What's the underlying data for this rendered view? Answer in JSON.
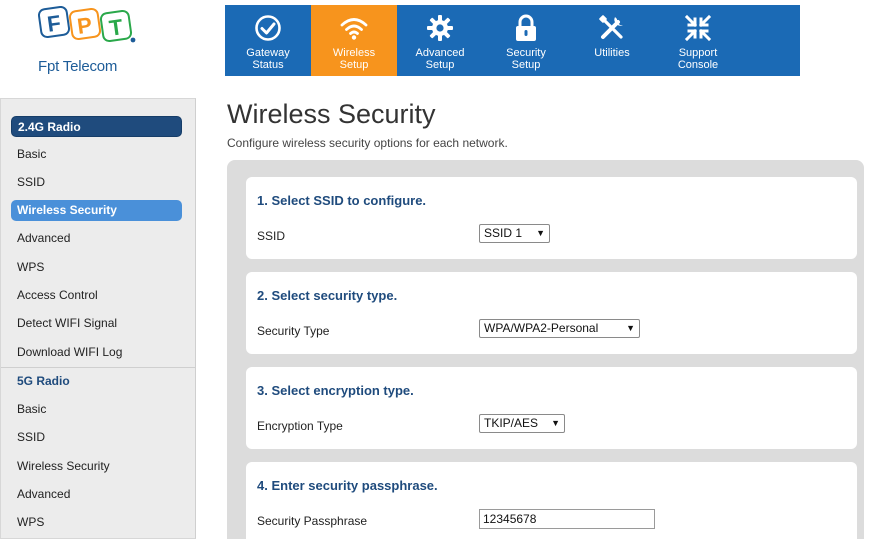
{
  "brand": {
    "logo_letters": [
      "F",
      "P",
      "T"
    ],
    "logo_colors": [
      "#1d5c98",
      "#f7941d",
      "#2aa84a"
    ],
    "name": "Fpt Telecom"
  },
  "nav": {
    "items": [
      {
        "label": "Gateway\nStatus",
        "icon": "check-circle-icon",
        "active": false
      },
      {
        "label": "Wireless\nSetup",
        "icon": "wifi-icon",
        "active": true
      },
      {
        "label": "Advanced\nSetup",
        "icon": "gear-icon",
        "active": false
      },
      {
        "label": "Security\nSetup",
        "icon": "lock-icon",
        "active": false
      },
      {
        "label": "Utilities",
        "icon": "tools-icon",
        "active": false
      },
      {
        "label": "Support\nConsole",
        "icon": "compress-arrows-icon",
        "active": false
      }
    ]
  },
  "sidebar": {
    "group_24": "2.4G Radio",
    "items_24": [
      "Basic",
      "SSID",
      "Wireless Security",
      "Advanced",
      "WPS",
      "Access Control",
      "Detect WIFI Signal",
      "Download WIFI Log"
    ],
    "active_24": "Wireless Security",
    "group_5": "5G Radio",
    "items_5": [
      "Basic",
      "SSID",
      "Wireless Security",
      "Advanced",
      "WPS"
    ]
  },
  "page": {
    "title": "Wireless Security",
    "subtitle": "Configure wireless security options for each network."
  },
  "sections": {
    "ssid": {
      "title": "1. Select SSID to configure.",
      "label": "SSID",
      "value": "SSID 1"
    },
    "security": {
      "title": "2. Select security type.",
      "label": "Security Type",
      "value": "WPA/WPA2-Personal"
    },
    "encryption": {
      "title": "3. Select encryption type.",
      "label": "Encryption Type",
      "value": "TKIP/AES"
    },
    "passphrase": {
      "title": "4. Enter security passphrase.",
      "label": "Security Passphrase",
      "value": "12345678"
    }
  },
  "colors": {
    "nav_blue": "#1b6ab5",
    "nav_active": "#f7941d",
    "sidebar_dark": "#1f4b7d",
    "sidebar_active": "#4a90d9"
  }
}
